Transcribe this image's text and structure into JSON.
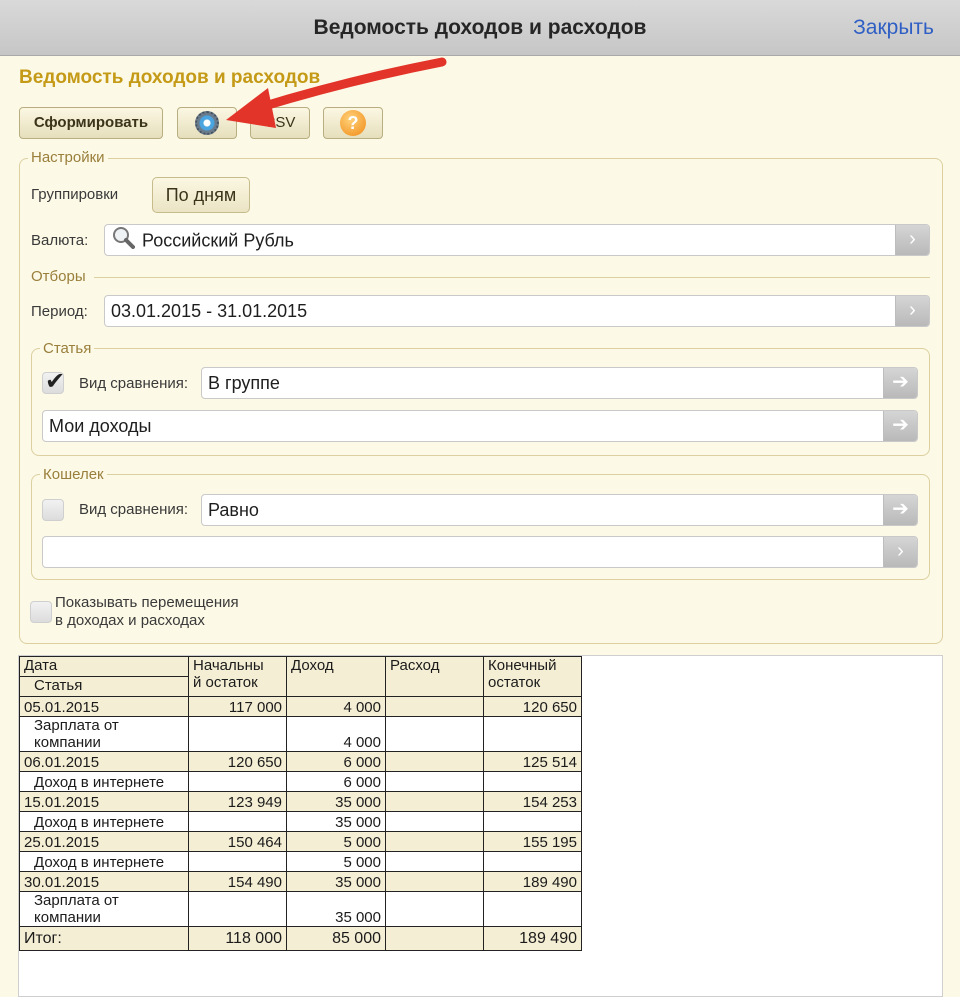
{
  "window": {
    "title": "Ведомость доходов и расходов",
    "close_label": "Закрыть"
  },
  "form_title": "Ведомость доходов и расходов",
  "toolbar": {
    "generate_label": "Сформировать",
    "csv_label": "CSV",
    "help_label": "?"
  },
  "settings": {
    "legend": "Настройки",
    "grouping_label": "Группировки",
    "grouping_value": "По дням",
    "currency_label": "Валюта:",
    "currency_value": "Российский Рубль"
  },
  "filters": {
    "legend": "Отборы",
    "period_label": "Период:",
    "period_value": "03.01.2015 - 31.01.2015",
    "article": {
      "legend": "Статья",
      "checked": true,
      "compare_label": "Вид сравнения:",
      "compare_value": "В группе",
      "value": "Мои доходы"
    },
    "wallet": {
      "legend": "Кошелек",
      "checked": false,
      "compare_label": "Вид сравнения:",
      "compare_value": "Равно",
      "value": ""
    },
    "show_transfers_line1": "Показывать перемещения",
    "show_transfers_line2": "в доходах и расходах"
  },
  "report": {
    "headers": {
      "date": "Дата",
      "article": "Статья",
      "start_line1": "Начальны",
      "start_line2": "й остаток",
      "income": "Доход",
      "expense": "Расход",
      "end_line1": "Конечный",
      "end_line2": "остаток"
    },
    "rows": [
      {
        "date": "05.01.2015",
        "start": "117 000",
        "income": "4 000",
        "expense": "",
        "end": "120 650",
        "items": [
          {
            "line1": "Зарплата от",
            "line2": "компании",
            "income": "4 000"
          }
        ]
      },
      {
        "date": "06.01.2015",
        "start": "120 650",
        "income": "6 000",
        "expense": "",
        "end": "125 514",
        "items": [
          {
            "line1": "Доход в интернете",
            "line2": "",
            "income": "6 000"
          }
        ]
      },
      {
        "date": "15.01.2015",
        "start": "123 949",
        "income": "35 000",
        "expense": "",
        "end": "154 253",
        "items": [
          {
            "line1": "Доход в интернете",
            "line2": "",
            "income": "35 000"
          }
        ]
      },
      {
        "date": "25.01.2015",
        "start": "150 464",
        "income": "5 000",
        "expense": "",
        "end": "155 195",
        "items": [
          {
            "line1": "Доход в интернете",
            "line2": "",
            "income": "5 000"
          }
        ]
      },
      {
        "date": "30.01.2015",
        "start": "154 490",
        "income": "35 000",
        "expense": "",
        "end": "189 490",
        "items": [
          {
            "line1": "Зарплата от",
            "line2": "компании",
            "income": "35 000"
          }
        ]
      }
    ],
    "total": {
      "label": "Итог:",
      "start": "118 000",
      "income": "85 000",
      "expense": "",
      "end": "189 490"
    }
  },
  "colors": {
    "accent_title": "#c49a17",
    "link": "#2f5fc4",
    "arrow": "#e3342a",
    "table_header_bg": "#f4eed4"
  }
}
